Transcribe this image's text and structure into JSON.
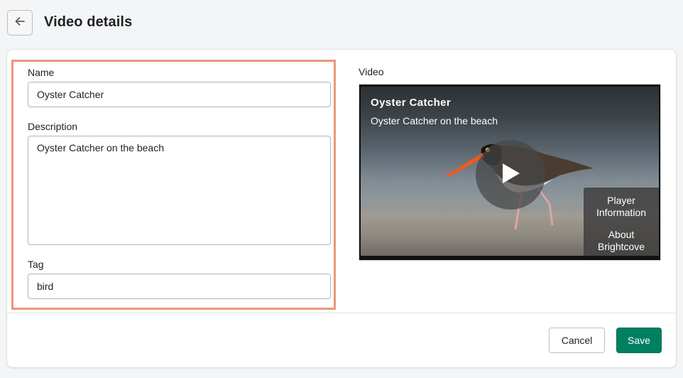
{
  "header": {
    "title": "Video details",
    "back_icon": "arrow-left-icon"
  },
  "form": {
    "name_label": "Name",
    "name_value": "Oyster Catcher",
    "description_label": "Description",
    "description_value": "Oyster Catcher on the beach",
    "tag_label": "Tag",
    "tag_value": "bird",
    "highlight_color": "#e9987a"
  },
  "video": {
    "label": "Video",
    "title": "Oyster Catcher",
    "description": "Oyster Catcher on the beach",
    "play_icon": "play-icon",
    "menu": {
      "player_information": "Player Information",
      "about": "About Brightcove"
    }
  },
  "actions": {
    "cancel_label": "Cancel",
    "save_label": "Save",
    "save_color": "#008060"
  }
}
